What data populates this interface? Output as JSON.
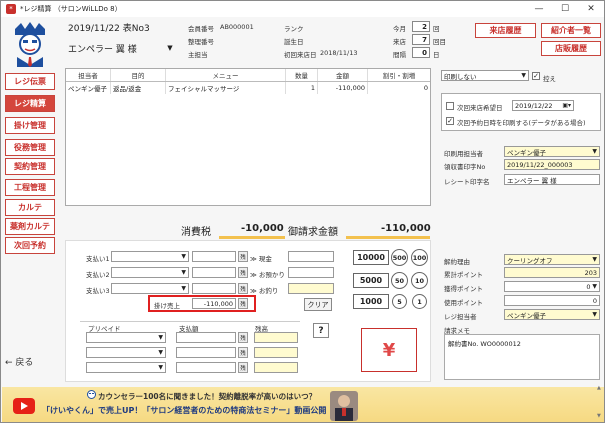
{
  "window": {
    "title": "*レジ精算 （サロンWiLLDo 8）",
    "minimize": "—",
    "maximize": "☐",
    "close": "✕"
  },
  "sidebar": {
    "items": [
      {
        "label": "レジ伝票",
        "active": false
      },
      {
        "label": "レジ精算",
        "active": true
      },
      {
        "label": "掛け管理",
        "active": false
      },
      {
        "label": "役務管理",
        "active": false
      },
      {
        "label": "契約管理",
        "active": false
      },
      {
        "label": "工程管理",
        "active": false
      },
      {
        "label": "カルテ",
        "active": false
      },
      {
        "label": "薬剤カルテ",
        "active": false
      },
      {
        "label": "次回予約",
        "active": false
      }
    ],
    "back_label": "← 戻る"
  },
  "header": {
    "date_slip": "2019/11/22  表No3",
    "customer_name": "エンペラー 翼  様",
    "member_no_label": "会員番号",
    "member_no_value": "AB000001",
    "rank_label": "ランク",
    "seiri_label": "整理番号",
    "birthday_label": "誕生日",
    "main_staff_label": "主担当",
    "first_visit_label": "初回来店日",
    "first_visit_value": "2018/11/13",
    "this_month_label": "今月",
    "this_month_value": "2",
    "this_month_unit": "回",
    "visits_label": "来店",
    "visits_value": "7",
    "visits_unit": "回目",
    "interval_label": "間隔",
    "interval_value": "0",
    "interval_unit": "日",
    "visit_history_btn": "来店履歴",
    "referrer_list_btn": "紹介者一覧",
    "sales_history_btn": "店販履歴"
  },
  "table": {
    "columns": [
      "担当者",
      "目的",
      "メニュー",
      "数量",
      "金額",
      "割引・割増"
    ],
    "rows": [
      {
        "staff": "ペンギン優子",
        "purpose": "返品/返金",
        "menu": "フェイシャルマッサージ",
        "qty": "1",
        "amount": "-110,000",
        "discount": "0"
      }
    ]
  },
  "totals": {
    "tax_label": "消費税",
    "tax_value": "-10,000",
    "total_label": "御請求金額",
    "total_value": "-110,000"
  },
  "payment": {
    "pay1_label": "支払い1",
    "pay2_label": "支払い2",
    "pay3_label": "支払い3",
    "cash_label": "≫ 現金",
    "deposit_label": "≫ お預かり",
    "change_label": "≫ お釣り",
    "credit_sale_label": "掛け売上",
    "credit_sale_value": "-110,000",
    "clear_btn": "クリア",
    "prepaid_label": "プリペイド",
    "paid_amount_label": "支払額",
    "balance_label": "残高",
    "remain_btn": "残",
    "help_btn": "?",
    "checkout_icon": "¥",
    "bills": [
      "10000",
      "5000",
      "1000"
    ],
    "coins": [
      "500",
      "100",
      "50",
      "10",
      "5",
      "1"
    ]
  },
  "right_panel": {
    "print_select": "印刷しない",
    "copy_label": "控え",
    "copy_checked": true,
    "next_visit_label": "次回来店希望日",
    "next_visit_date": "2019/12/22",
    "print_next_label": "次回予約日時を印刷する(データがある場合)",
    "print_next_checked": true,
    "print_staff_label": "印刷用担当者",
    "print_staff_value": "ペンギン優子",
    "receipt_no_label": "領収書印字No",
    "receipt_no_value": "2019/11/22_000003",
    "receipt_name_label": "レシート印字名",
    "receipt_name_value": "エンペラー 翼 様",
    "cancel_reason_label": "解約理由",
    "cancel_reason_value": "クーリングオフ",
    "cumulative_points_label": "累計ポイント",
    "cumulative_points_value": "203",
    "earned_points_label": "獲得ポイント",
    "earned_points_value": "0",
    "used_points_label": "使用ポイント",
    "used_points_value": "0",
    "register_staff_label": "レジ担当者",
    "register_staff_value": "ペンギン優子",
    "memo_label": "請求メモ",
    "memo_value": "解約書No. WO0000012"
  },
  "banner": {
    "line1": "カウンセラー100名に聞きました！契約離脱率が高いのはいつ？",
    "line2": "「けいやくん」で売上UP！「サロン経営者のための特商法セミナー」動画公開",
    "colors": {
      "accent": "#c8302c",
      "youtube": "#e62117",
      "highlight": "#e02020"
    }
  }
}
